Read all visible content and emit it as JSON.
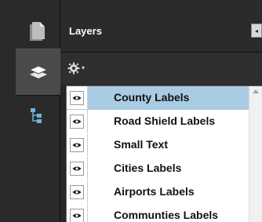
{
  "sidebar": {
    "buttons": [
      {
        "id": "pages",
        "icon": "page-icon"
      },
      {
        "id": "layers",
        "icon": "layers-icon",
        "active": true
      },
      {
        "id": "model-tree",
        "icon": "model-tree-icon"
      }
    ]
  },
  "panel": {
    "title": "Layers",
    "collapse_icon": "◂",
    "options_icon": "gear-icon",
    "options_caret": "▾"
  },
  "layers": [
    {
      "label": "County Labels",
      "visible": true,
      "selected": true
    },
    {
      "label": "Road Shield Labels",
      "visible": true,
      "selected": false
    },
    {
      "label": "Small Text",
      "visible": true,
      "selected": false
    },
    {
      "label": "Cities Labels",
      "visible": true,
      "selected": false
    },
    {
      "label": "Airports Labels",
      "visible": true,
      "selected": false
    },
    {
      "label": "Communties Labels",
      "visible": true,
      "selected": false
    }
  ],
  "colors": {
    "selected_row": "#a9cbe3",
    "panel_bg": "#262626"
  }
}
